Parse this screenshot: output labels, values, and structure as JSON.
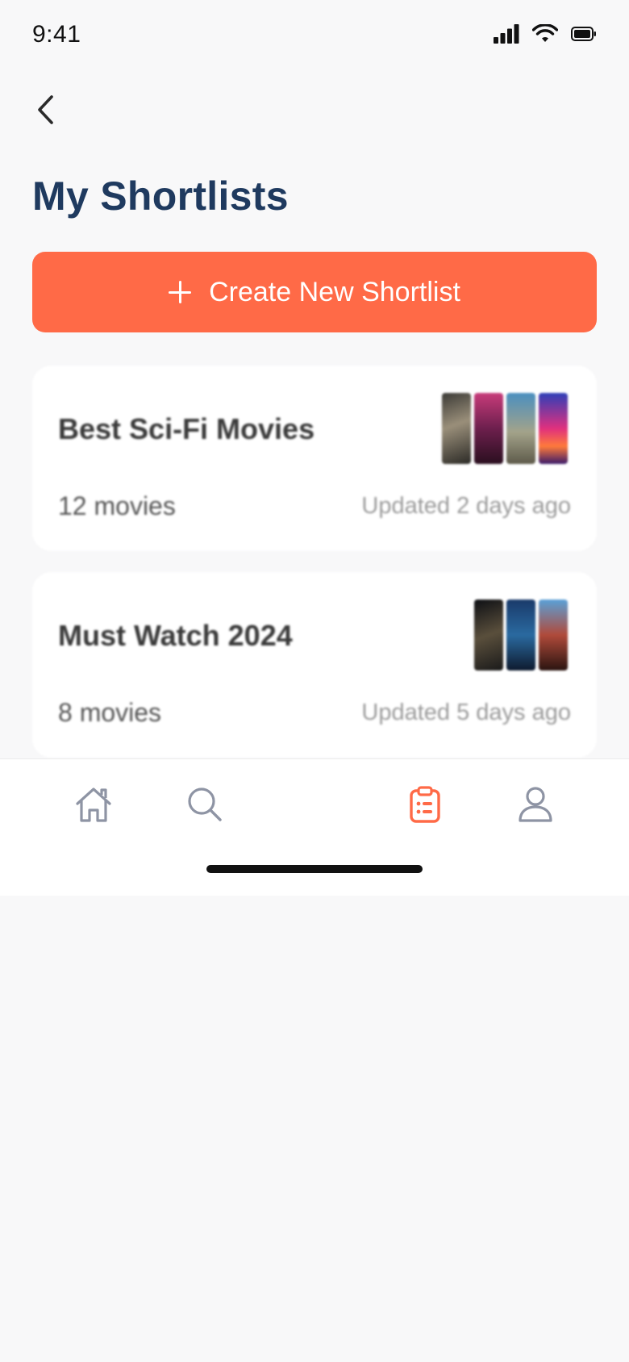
{
  "status_bar": {
    "time": "9:41"
  },
  "header": {
    "title": "My Shortlists"
  },
  "create_button": {
    "label": "Create New Shortlist"
  },
  "shortlists": [
    {
      "title": "Best Sci-Fi Movies",
      "count": "12 movies",
      "updated": "Updated 2 days ago"
    },
    {
      "title": "Must Watch 2024",
      "count": "8 movies",
      "updated": "Updated 5 days ago"
    }
  ],
  "tab_bar": {
    "items": [
      {
        "icon": "home-icon",
        "active": false
      },
      {
        "icon": "search-icon",
        "active": false
      },
      {
        "icon": "clipboard-icon",
        "active": true
      },
      {
        "icon": "person-icon",
        "active": false
      }
    ],
    "active_color": "#ff6a47",
    "inactive_color": "#8e94a4"
  },
  "colors": {
    "accent": "#ff6a47",
    "title": "#1f3a5f"
  }
}
